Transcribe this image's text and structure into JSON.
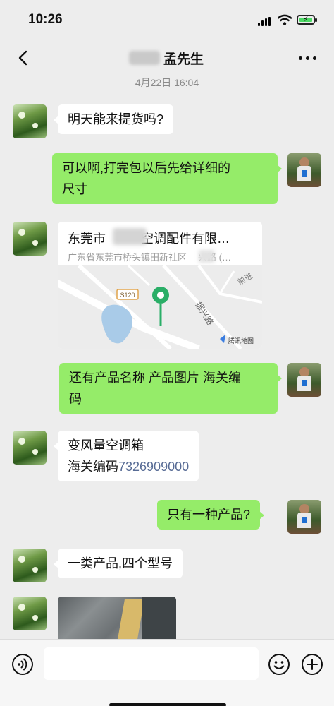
{
  "status_bar": {
    "time": "10:26",
    "battery": "charging"
  },
  "header": {
    "contact_name": "孟先生",
    "back_icon": "chevron-left-icon",
    "more_icon": "more-dots-icon"
  },
  "chat": {
    "timestamp": "4月22日 16:04",
    "messages": [
      {
        "from": "contact",
        "type": "text",
        "text": "明天能来提货吗?"
      },
      {
        "from": "me",
        "type": "text",
        "lines": [
          "可以啊,打完包以后先给详细的",
          "尺寸"
        ]
      },
      {
        "from": "contact",
        "type": "location",
        "title": "东莞市",
        "title_suffix": "空调配件有限…",
        "address": "广东省东莞市桥头镇田新社区",
        "address_suffix": "兴路 (…",
        "map": {
          "road_badge": "S120",
          "road_name": "振兴路",
          "area_label": "前进",
          "provider": "腾讯地图"
        }
      },
      {
        "from": "me",
        "type": "text",
        "lines": [
          "还有产品名称 产品图片 海关编",
          "码"
        ]
      },
      {
        "from": "contact",
        "type": "text",
        "line1": "变风量空调箱",
        "line2_prefix": "海关编码",
        "line2_link": "7326909000"
      },
      {
        "from": "me",
        "type": "text",
        "text": "只有一种产品?"
      },
      {
        "from": "contact",
        "type": "text",
        "text": "一类产品,四个型号"
      },
      {
        "from": "contact",
        "type": "image"
      }
    ]
  },
  "input_bar": {
    "voice_icon": "voice-icon",
    "emoji_icon": "emoji-icon",
    "plus_icon": "plus-icon",
    "placeholder": ""
  },
  "colors": {
    "background": "#ededed",
    "incoming_bubble": "#ffffff",
    "outgoing_bubble": "#95ec69",
    "link": "#576b95",
    "map_pin": "#2aae67"
  }
}
